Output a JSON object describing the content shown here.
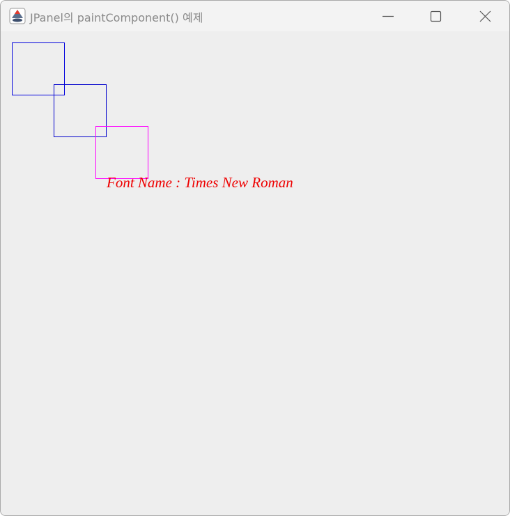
{
  "window": {
    "title": "JPanel의 paintComponent() 예제",
    "app_icon": "java-icon",
    "controls": {
      "minimize_icon": "minimize-icon",
      "maximize_icon": "maximize-icon",
      "close_icon": "close-icon"
    }
  },
  "canvas": {
    "rectangles": [
      {
        "color": "#0000dd"
      },
      {
        "color": "#0000cc"
      },
      {
        "color": "#ff00ff"
      }
    ],
    "font_text": "Font Name : Times New Roman",
    "font_text_color": "#ee0000"
  }
}
